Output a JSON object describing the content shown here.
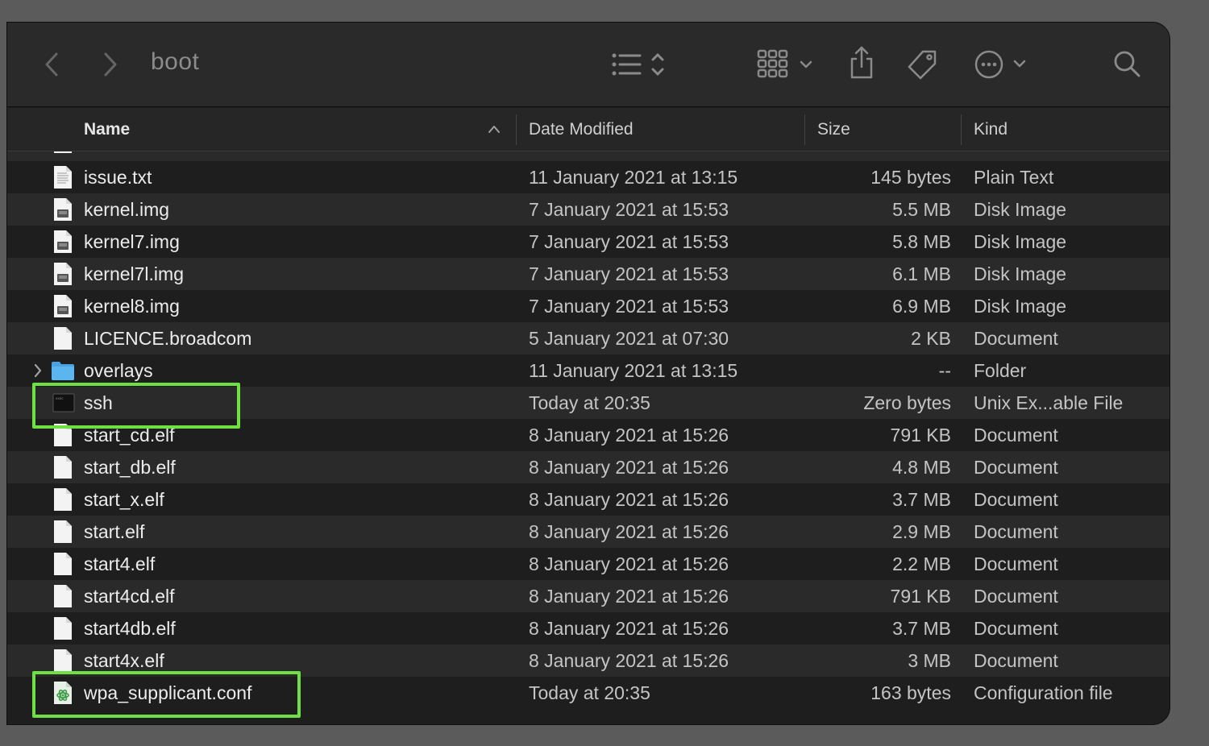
{
  "toolbar": {
    "title": "boot",
    "icons": [
      "back-icon",
      "forward-icon",
      "list-view-icon",
      "group-icon",
      "share-icon",
      "tag-icon",
      "more-icon",
      "search-icon"
    ]
  },
  "columns": {
    "name": "Name",
    "date": "Date Modified",
    "size": "Size",
    "kind": "Kind"
  },
  "files": [
    {
      "name": "issue.txt",
      "date": "11 January 2021 at 13:15",
      "size": "145 bytes",
      "kind": "Plain Text",
      "icon": "text-file-icon"
    },
    {
      "name": "kernel.img",
      "date": "7 January 2021 at 15:53",
      "size": "5.5 MB",
      "kind": "Disk Image",
      "icon": "disk-image-icon"
    },
    {
      "name": "kernel7.img",
      "date": "7 January 2021 at 15:53",
      "size": "5.8 MB",
      "kind": "Disk Image",
      "icon": "disk-image-icon"
    },
    {
      "name": "kernel7l.img",
      "date": "7 January 2021 at 15:53",
      "size": "6.1 MB",
      "kind": "Disk Image",
      "icon": "disk-image-icon"
    },
    {
      "name": "kernel8.img",
      "date": "7 January 2021 at 15:53",
      "size": "6.9 MB",
      "kind": "Disk Image",
      "icon": "disk-image-icon"
    },
    {
      "name": "LICENCE.broadcom",
      "date": "5 January 2021 at 07:30",
      "size": "2 KB",
      "kind": "Document",
      "icon": "document-icon"
    },
    {
      "name": "overlays",
      "date": "11 January 2021 at 13:15",
      "size": "--",
      "kind": "Folder",
      "icon": "folder-icon"
    },
    {
      "name": "ssh",
      "date": "Today at 20:35",
      "size": "Zero bytes",
      "kind": "Unix Ex...able File",
      "icon": "terminal-exec-icon"
    },
    {
      "name": "start_cd.elf",
      "date": "8 January 2021 at 15:26",
      "size": "791 KB",
      "kind": "Document",
      "icon": "document-icon"
    },
    {
      "name": "start_db.elf",
      "date": "8 January 2021 at 15:26",
      "size": "4.8 MB",
      "kind": "Document",
      "icon": "document-icon"
    },
    {
      "name": "start_x.elf",
      "date": "8 January 2021 at 15:26",
      "size": "3.7 MB",
      "kind": "Document",
      "icon": "document-icon"
    },
    {
      "name": "start.elf",
      "date": "8 January 2021 at 15:26",
      "size": "2.9 MB",
      "kind": "Document",
      "icon": "document-icon"
    },
    {
      "name": "start4.elf",
      "date": "8 January 2021 at 15:26",
      "size": "2.2 MB",
      "kind": "Document",
      "icon": "document-icon"
    },
    {
      "name": "start4cd.elf",
      "date": "8 January 2021 at 15:26",
      "size": "791 KB",
      "kind": "Document",
      "icon": "document-icon"
    },
    {
      "name": "start4db.elf",
      "date": "8 January 2021 at 15:26",
      "size": "3.7 MB",
      "kind": "Document",
      "icon": "document-icon"
    },
    {
      "name": "start4x.elf",
      "date": "8 January 2021 at 15:26",
      "size": "3 MB",
      "kind": "Document",
      "icon": "document-icon"
    },
    {
      "name": "wpa_supplicant.conf",
      "date": "Today at 20:35",
      "size": "163 bytes",
      "kind": "Configuration file",
      "icon": "config-file-icon"
    }
  ],
  "highlight_color": "#6ee043"
}
